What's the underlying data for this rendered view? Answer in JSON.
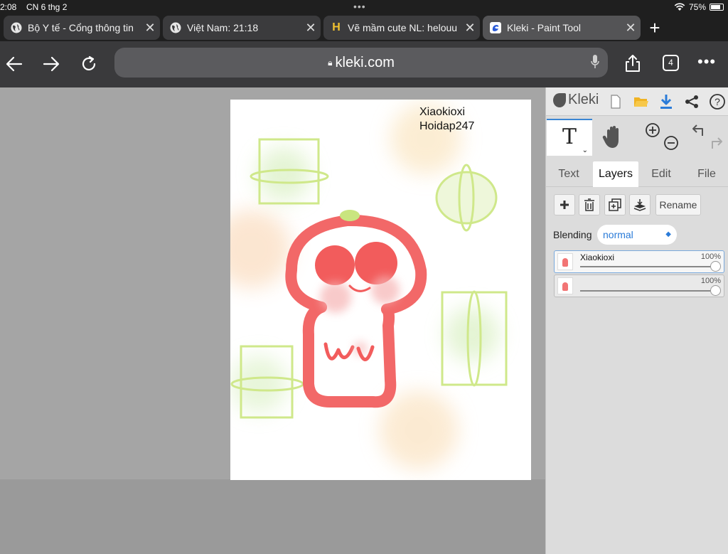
{
  "status": {
    "time": "2:08",
    "date": "CN 6 thg 2",
    "battery": "75%"
  },
  "tabs": [
    {
      "title": "Bộ Y tế - Cổng thông tin",
      "active": false
    },
    {
      "title": "Việt Nam: 21:18",
      "active": false
    },
    {
      "title": "Vẽ mầm cute NL: helouu",
      "active": false
    },
    {
      "title": "Kleki - Paint Tool",
      "active": true
    }
  ],
  "toolbar": {
    "url": "kleki.com",
    "tab_count": "4"
  },
  "canvas": {
    "signature_line1": "Xiaokioxi",
    "signature_line2": "Hoidap247"
  },
  "panel": {
    "logo": "Kleki",
    "tool_icon": "T",
    "tabs": [
      "Text",
      "Layers",
      "Edit",
      "File"
    ],
    "active_tab": "Layers",
    "rename_label": "Rename",
    "blending_label": "Blending",
    "blending_value": "normal",
    "layers": [
      {
        "name": "Xiaokioxi",
        "opacity": "100%",
        "selected": true
      },
      {
        "name": "",
        "opacity": "100%",
        "selected": false
      }
    ]
  },
  "colors": {
    "accent": "#2a7bd8",
    "drawing_red": "#f26868",
    "drawing_green": "#cfe88a",
    "drawing_orange": "#f6c890"
  }
}
